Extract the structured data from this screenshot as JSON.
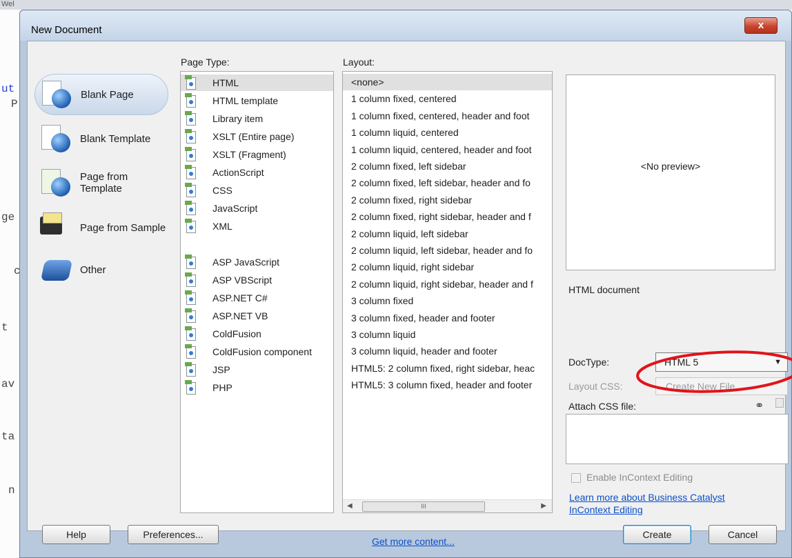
{
  "background_editor": {
    "strip_text": "Wel",
    "code_fragments": [
      "ut",
      "P",
      "ge",
      "c",
      "t",
      "av",
      "ta",
      "n"
    ]
  },
  "dialog": {
    "title": "New Document",
    "close_label": "x"
  },
  "categories": [
    {
      "label": "Blank Page",
      "icon": "blank-page-icon",
      "selected": true
    },
    {
      "label": "Blank Template",
      "icon": "blank-template-icon",
      "selected": false
    },
    {
      "label": "Page from Template",
      "icon": "page-from-template-icon",
      "selected": false
    },
    {
      "label": "Page from Sample",
      "icon": "page-from-sample-icon",
      "selected": false
    },
    {
      "label": "Other",
      "icon": "other-icon",
      "selected": false
    }
  ],
  "page_type": {
    "header": "Page Type:",
    "items": [
      "HTML",
      "HTML template",
      "Library item",
      "XSLT (Entire page)",
      "XSLT (Fragment)",
      "ActionScript",
      "CSS",
      "JavaScript",
      "XML",
      "ASP JavaScript",
      "ASP VBScript",
      "ASP.NET C#",
      "ASP.NET VB",
      "ColdFusion",
      "ColdFusion component",
      "JSP",
      "PHP"
    ],
    "selected": "HTML"
  },
  "layout": {
    "header": "Layout:",
    "items": [
      "<none>",
      "1 column fixed, centered",
      "1 column fixed, centered, header and foot",
      "1 column liquid, centered",
      "1 column liquid, centered, header and foot",
      "2 column fixed, left sidebar",
      "2 column fixed, left sidebar, header and fo",
      "2 column fixed, right sidebar",
      "2 column fixed, right sidebar, header and f",
      "2 column liquid, left sidebar",
      "2 column liquid, left sidebar, header and fo",
      "2 column liquid, right sidebar",
      "2 column liquid, right sidebar, header and f",
      "3 column fixed",
      "3 column fixed, header and footer",
      "3 column liquid",
      "3 column liquid, header and footer",
      "HTML5: 2 column fixed, right sidebar, heac",
      "HTML5: 3 column fixed, header and footer"
    ],
    "selected": "<none>",
    "scroll_thumb_grip": "III"
  },
  "preview": {
    "placeholder": "<No preview>",
    "description": "HTML document"
  },
  "doctype": {
    "label": "DocType:",
    "value": "HTML 5"
  },
  "layout_css": {
    "label": "Layout CSS:",
    "value": "Create New File"
  },
  "attach_css": {
    "label": "Attach CSS file:",
    "link_icon": "chain-link-icon",
    "remove_icon": "trash-icon"
  },
  "incontext": {
    "checkbox_label": "Enable InContext Editing",
    "checked": false,
    "learn_more_link": "Learn more about Business Catalyst InContext Editing"
  },
  "footer": {
    "help_label": "Help",
    "preferences_label": "Preferences...",
    "get_more_link": "Get more content...",
    "create_label": "Create",
    "cancel_label": "Cancel"
  },
  "colors": {
    "annotation_ellipse": "#e0141b",
    "selection": "#e0e0e0",
    "link": "#0b4fc7"
  }
}
